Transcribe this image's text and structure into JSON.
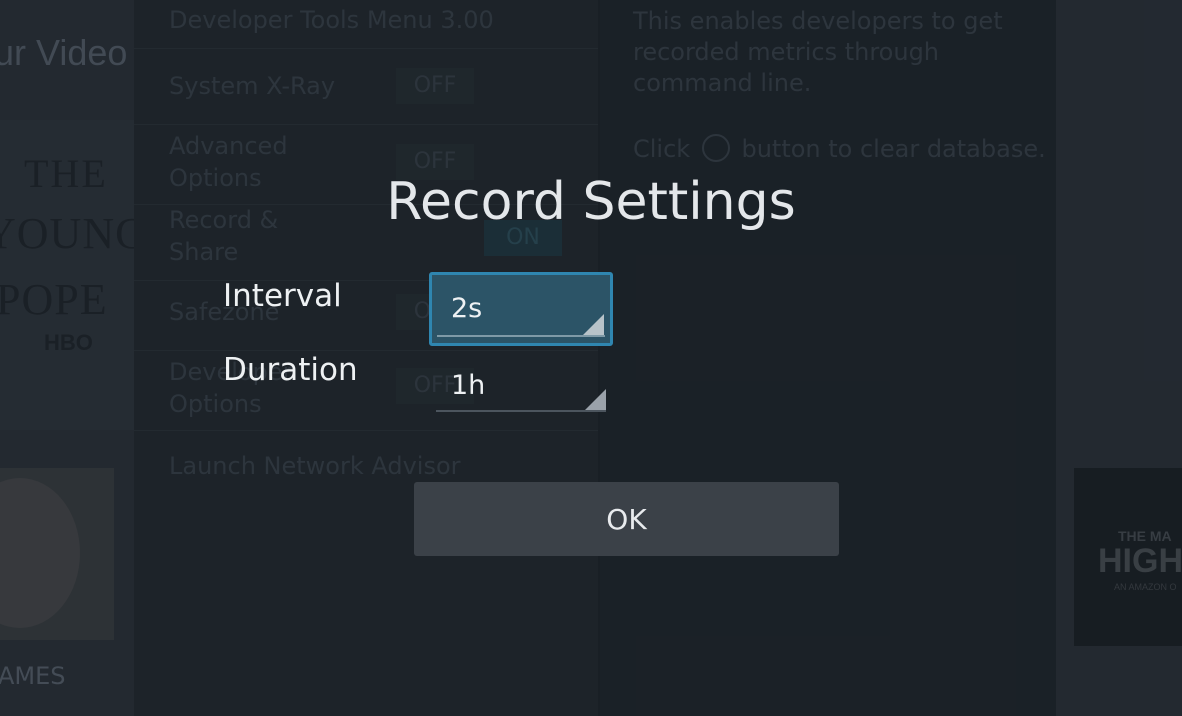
{
  "background": {
    "left_title_fragment": "ur Video",
    "poster": {
      "line1": "THE",
      "line2": "YOUNG",
      "line3": "POPE",
      "network": "HBO"
    },
    "games_fragment": "AMES",
    "menu": {
      "header": "Developer Tools Menu 3.00",
      "rows": [
        {
          "label": "System X-Ray",
          "toggle": "OFF"
        },
        {
          "label": "Advanced\nOptions",
          "toggle": "OFF"
        },
        {
          "label": "Record &\nShare",
          "toggle": "ON"
        },
        {
          "label": "Safezone",
          "toggle": "OFF"
        },
        {
          "label": "Developer\nOptions",
          "toggle": "OFF"
        },
        {
          "label": "Launch Network Advisor",
          "toggle": ""
        }
      ]
    },
    "description": {
      "text": "This enables developers to get recorded metrics through command line.",
      "hint_prefix": "Click",
      "hint_suffix": "button to clear database."
    },
    "right_poster": {
      "top": "THE MA",
      "main": "HIGH C",
      "sub": "AN AMAZON O"
    }
  },
  "dialog": {
    "title": "Record Settings",
    "interval_label": "Interval",
    "interval_value": "2s",
    "duration_label": "Duration",
    "duration_value": "1h",
    "ok_label": "OK"
  },
  "colors": {
    "focus_border": "#2f86b0",
    "focus_fill": "#2c5467",
    "button_fill": "#3b4148"
  }
}
